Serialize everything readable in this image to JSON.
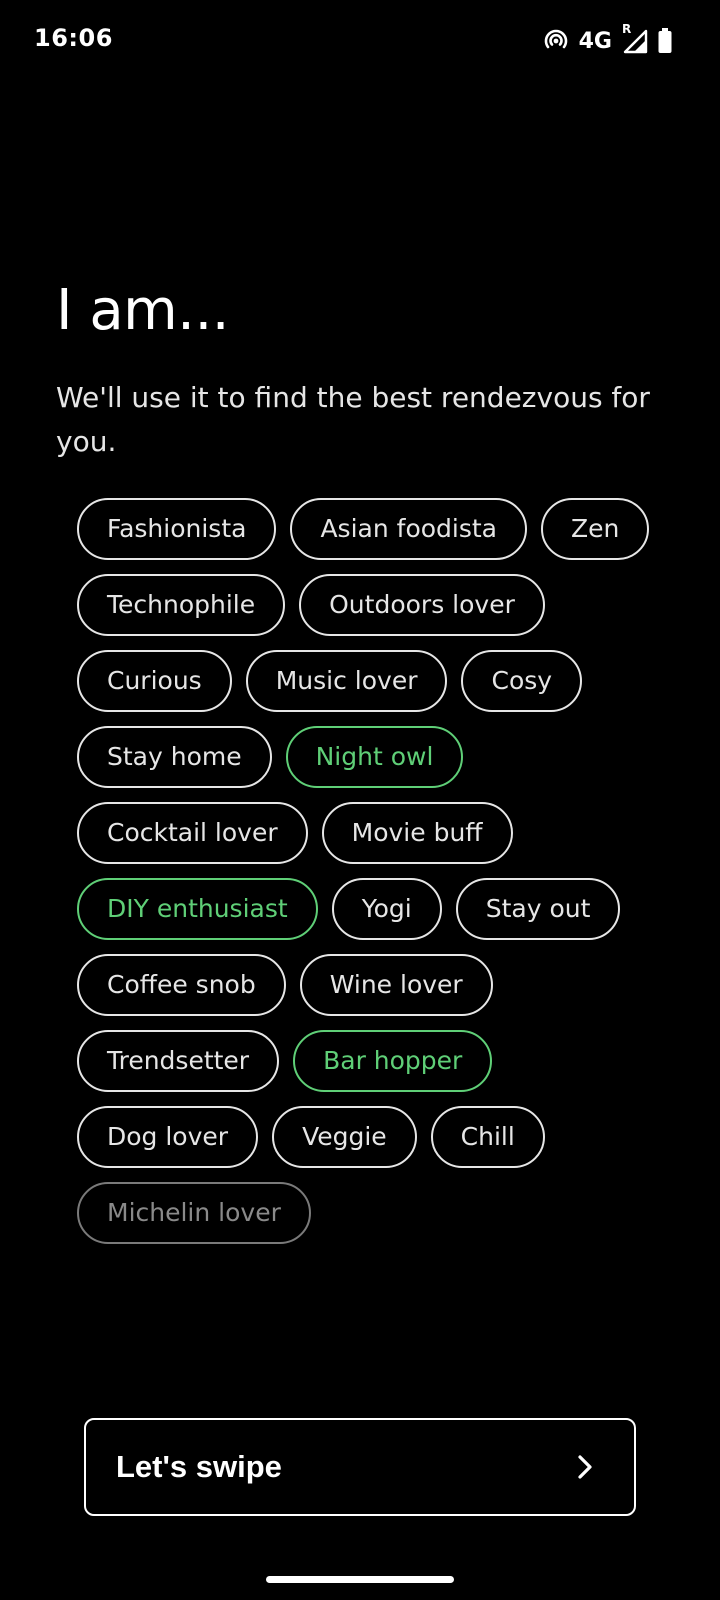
{
  "status_bar": {
    "time": "16:06",
    "network": "4G",
    "roaming_indicator": "R",
    "icons": [
      "hotspot-icon",
      "signal-icon",
      "battery-icon"
    ]
  },
  "header": {
    "title": "I am...",
    "subtitle": "We'll use it to find the best rendezvous for you."
  },
  "tags": [
    {
      "label": "Fashionista",
      "state": "default"
    },
    {
      "label": "Asian foodista",
      "state": "default"
    },
    {
      "label": "Zen",
      "state": "default"
    },
    {
      "label": "Technophile",
      "state": "default"
    },
    {
      "label": "Outdoors lover",
      "state": "default"
    },
    {
      "label": "Curious",
      "state": "default"
    },
    {
      "label": "Music lover",
      "state": "default"
    },
    {
      "label": "Cosy",
      "state": "default"
    },
    {
      "label": "Stay home",
      "state": "default"
    },
    {
      "label": "Night owl",
      "state": "selected"
    },
    {
      "label": "Cocktail lover",
      "state": "default"
    },
    {
      "label": "Movie buff",
      "state": "default"
    },
    {
      "label": "DIY enthusiast",
      "state": "selected"
    },
    {
      "label": "Yogi",
      "state": "default"
    },
    {
      "label": "Stay out",
      "state": "default"
    },
    {
      "label": "Coffee snob",
      "state": "default"
    },
    {
      "label": "Wine lover",
      "state": "default"
    },
    {
      "label": "Trendsetter",
      "state": "default"
    },
    {
      "label": "Bar hopper",
      "state": "selected"
    },
    {
      "label": "Dog lover",
      "state": "default"
    },
    {
      "label": "Veggie",
      "state": "default"
    },
    {
      "label": "Chill",
      "state": "default"
    },
    {
      "label": "Michelin lover",
      "state": "dimmed"
    }
  ],
  "cta": {
    "label": "Let's swipe",
    "icon": "chevron-right-icon"
  },
  "colors": {
    "background": "#000000",
    "text": "#ffffff",
    "tag_border": "#e6e6e6",
    "selected": "#5fcf77",
    "dimmed": "#7a7a7a"
  }
}
